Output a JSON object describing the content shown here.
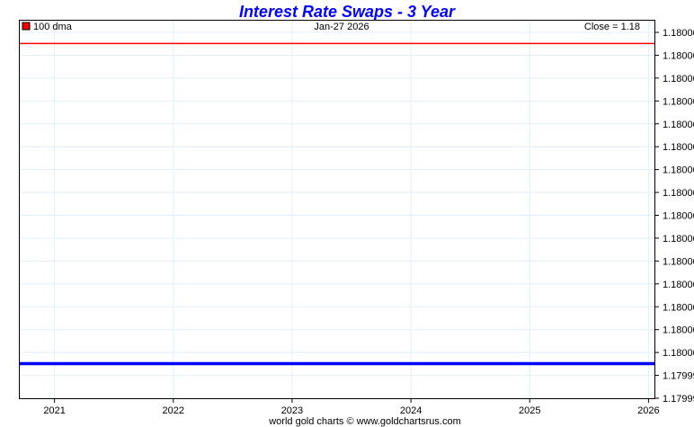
{
  "chart_data": {
    "type": "line",
    "title": "Interest Rate Swaps - 3 Year",
    "date_label": "Jan-27  2026",
    "close_label": "Close = 1.18",
    "legend": [
      {
        "name": "100 dma",
        "color": "#ff0000"
      }
    ],
    "footer": "world gold charts © www.goldchartsrus.com",
    "x_ticks": [
      "2021",
      "2022",
      "2023",
      "2024",
      "2025",
      "2026"
    ],
    "x_range": [
      2020.7,
      2026.05
    ],
    "y_tick_labels": [
      "1.18000",
      "1.18000",
      "1.18000",
      "1.18000",
      "1.18000",
      "1.18000",
      "1.18000",
      "1.18000",
      "1.18000",
      "1.18000",
      "1.18000",
      "1.18000",
      "1.18000",
      "1.18000",
      "1.18000",
      "1.17999",
      "1.17999"
    ],
    "y_range": [
      1.179985,
      1.180017
    ],
    "series": [
      {
        "name": "100 dma",
        "color": "#ff0000",
        "x": [
          2020.7,
          2026.05
        ],
        "y": [
          1.180015,
          1.180015
        ]
      },
      {
        "name": "Close",
        "color": "#0000ff",
        "x": [
          2020.7,
          2026.05
        ],
        "y": [
          1.179988,
          1.179988
        ]
      }
    ],
    "grid": true
  }
}
